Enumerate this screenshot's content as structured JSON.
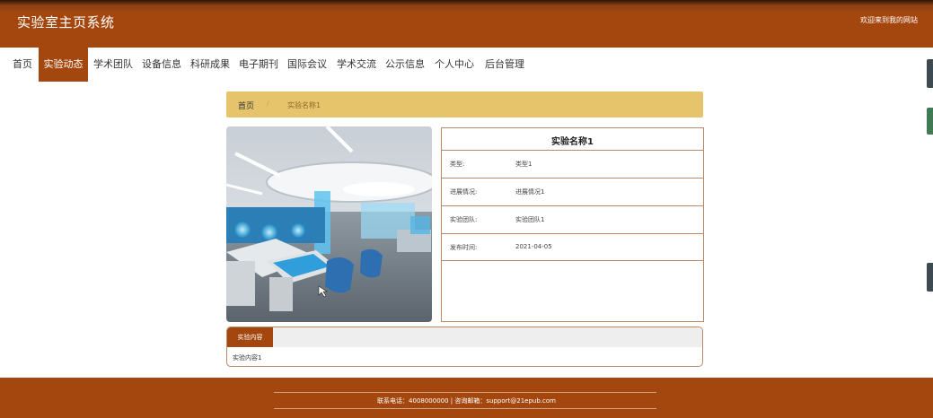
{
  "header": {
    "title": "实验室主页系统",
    "welcome": "欢迎来到我的网站"
  },
  "nav": {
    "items": [
      {
        "label": "首页",
        "active": false
      },
      {
        "label": "实验动态",
        "active": true
      },
      {
        "label": "学术团队",
        "active": false
      },
      {
        "label": "设备信息",
        "active": false
      },
      {
        "label": "科研成果",
        "active": false
      },
      {
        "label": "电子期刊",
        "active": false
      },
      {
        "label": "国际会议",
        "active": false
      },
      {
        "label": "学术交流",
        "active": false
      },
      {
        "label": "公示信息",
        "active": false
      },
      {
        "label": "个人中心",
        "active": false
      },
      {
        "label": "后台管理",
        "active": false
      }
    ]
  },
  "breadcrumb": {
    "home": "首页",
    "separator": "/",
    "current": "实验名称1"
  },
  "detail": {
    "title": "实验名称1",
    "fields": [
      {
        "label": "类型:",
        "value": "类型1"
      },
      {
        "label": "进展情况:",
        "value": "进展情况1"
      },
      {
        "label": "实验团队:",
        "value": "实验团队1"
      },
      {
        "label": "发布时间:",
        "value": "2021-04-05"
      }
    ]
  },
  "content": {
    "tab": "实验内容",
    "text": "实验内容1"
  },
  "footer": {
    "text": "联系电话：4008000000 | 咨询邮箱：support@21epub.com"
  },
  "colors": {
    "brand": "#a4470f",
    "breadcrumb_bg": "#e5c46c",
    "border": "#b98a6c"
  }
}
